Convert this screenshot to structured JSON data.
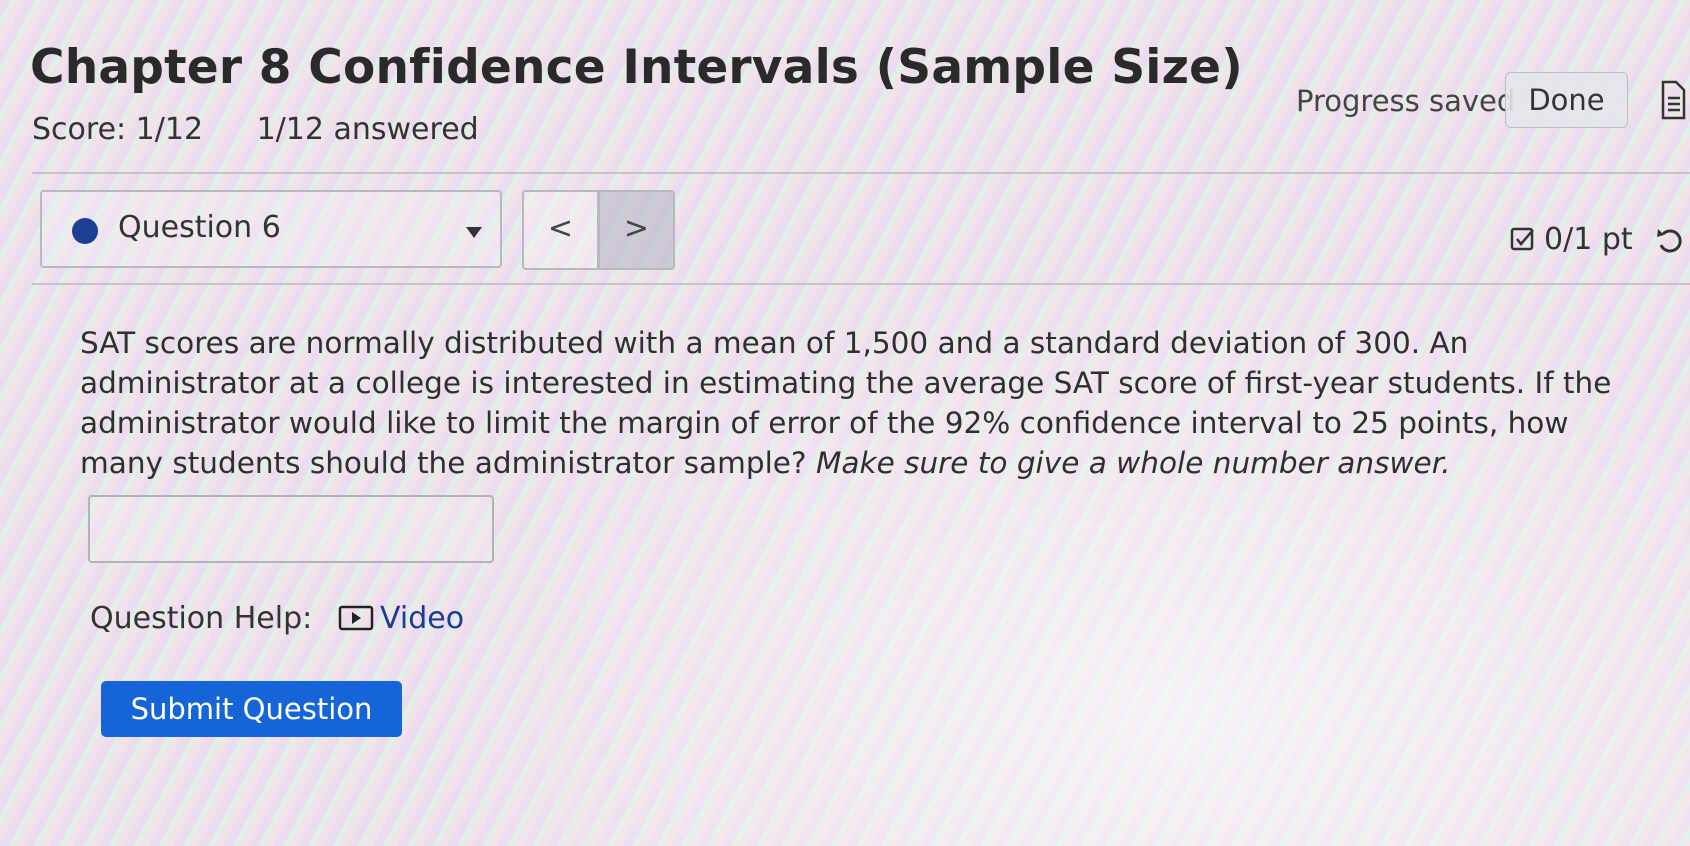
{
  "header": {
    "title": "Chapter 8 Confidence Intervals (Sample Size)",
    "score": "Score: 1/12",
    "answered": "1/12 answered",
    "progress_saved": "Progress saved",
    "done_label": "Done"
  },
  "question_nav": {
    "selected": "Question 6",
    "prev_glyph": "<",
    "next_glyph": ">",
    "points": "0/1 pt"
  },
  "question": {
    "text": "SAT scores are normally distributed with a mean of 1,500 and a standard deviation of 300. An administrator at a college is interested in estimating the average SAT score of first-year students. If the administrator would like to limit the margin of error of the 92% confidence interval to 25 points, how many students should the administrator sample?",
    "instruction": "Make sure to give a whole number answer.",
    "answer_value": ""
  },
  "help": {
    "label": "Question Help:",
    "video_label": "Video"
  },
  "submit_label": "Submit Question",
  "icons": {
    "status_dot": "status-dot",
    "dropdown": "caret-down-icon",
    "prev": "chevron-left-icon",
    "next": "chevron-right-icon",
    "points": "checkbox-icon",
    "retry": "retry-icon",
    "video": "play-icon",
    "doc": "document-icon"
  },
  "colors": {
    "accent": "#1565d8",
    "status_dot": "#1d3f91",
    "link": "#1a3d8f"
  }
}
